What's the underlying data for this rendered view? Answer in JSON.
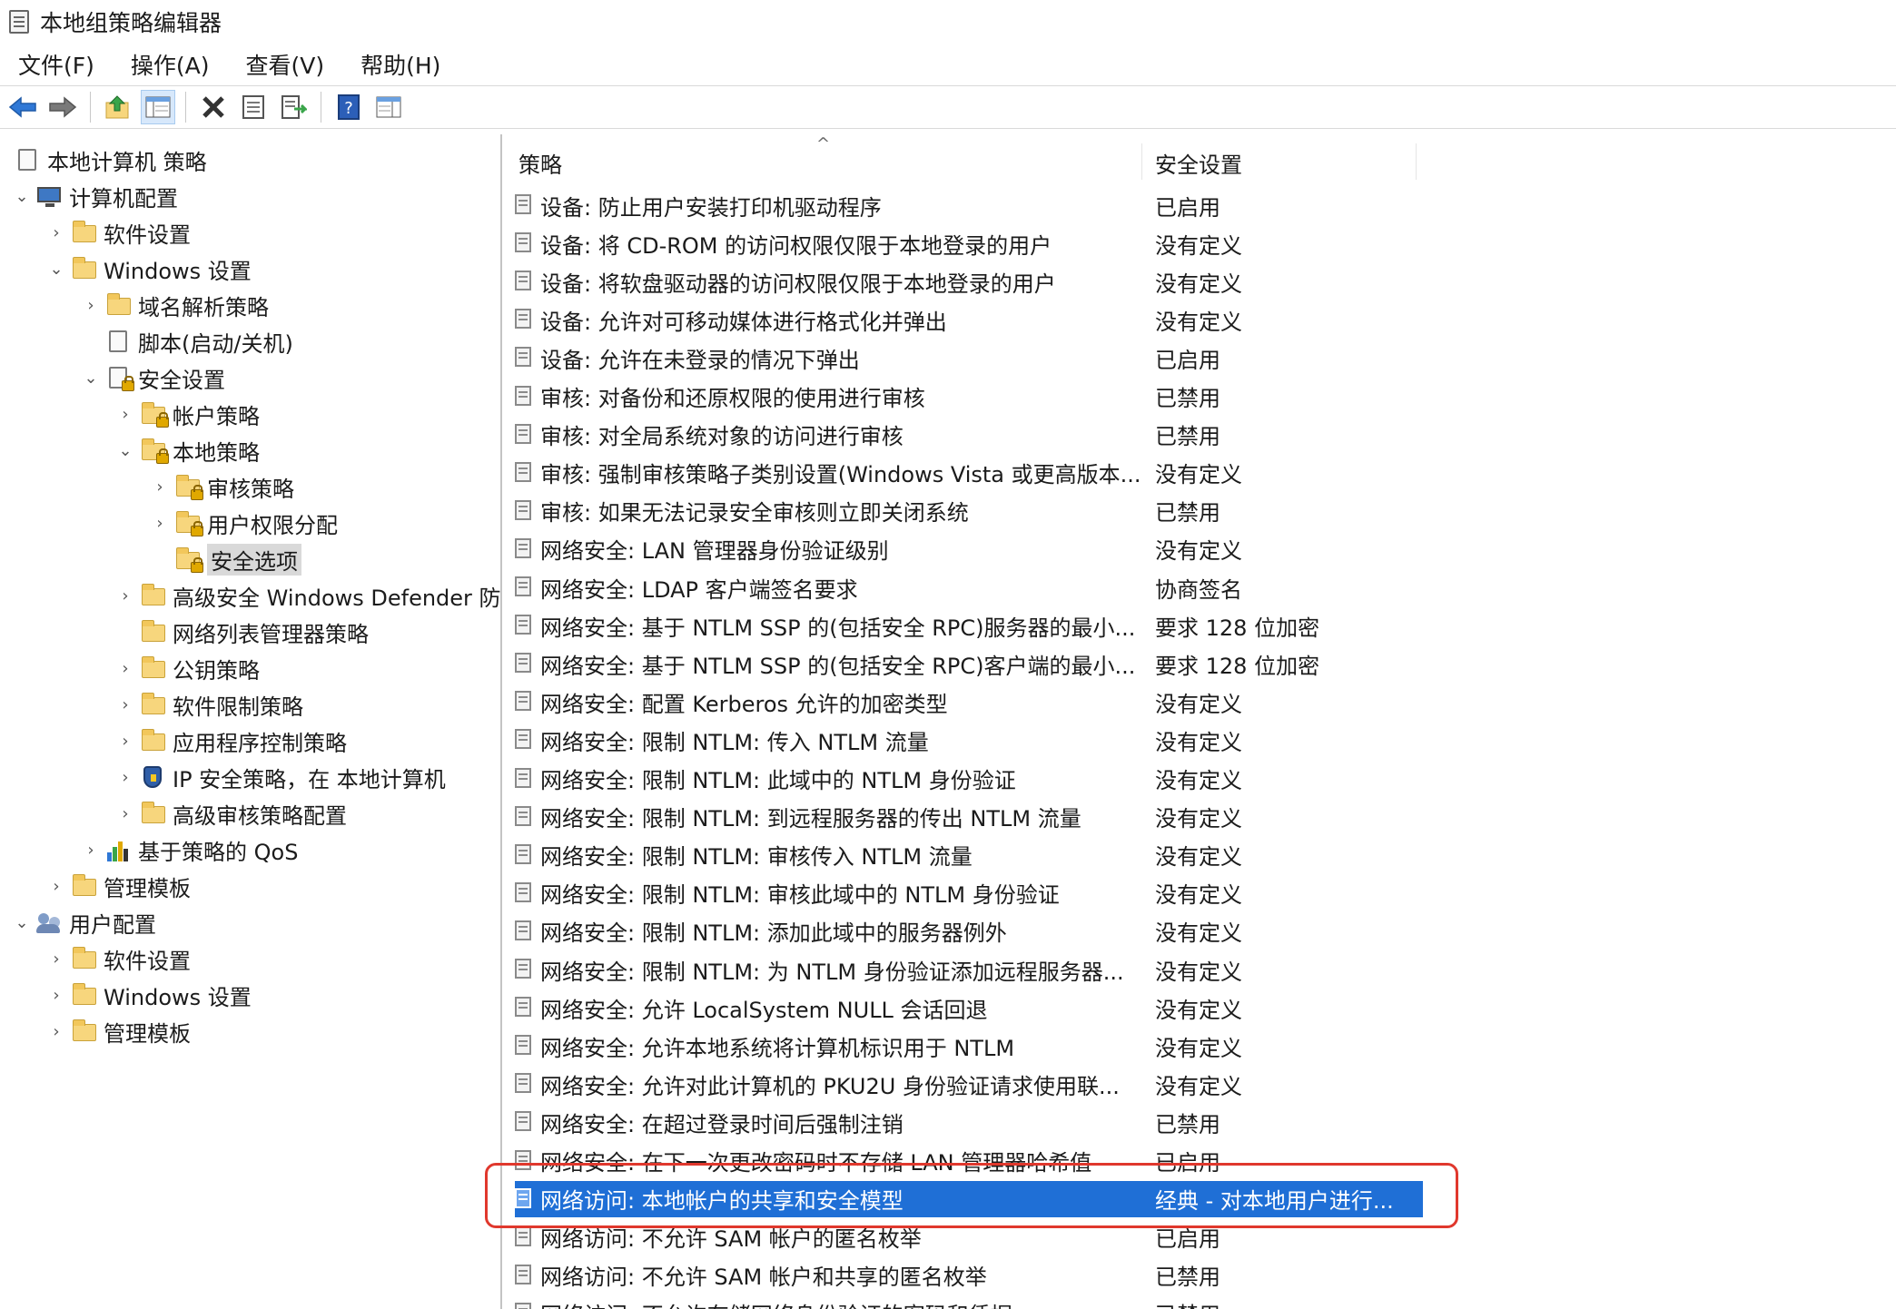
{
  "window": {
    "title": "本地组策略编辑器"
  },
  "menu": [
    "文件(F)",
    "操作(A)",
    "查看(V)",
    "帮助(H)"
  ],
  "toolbar_icons": [
    "back-icon",
    "forward-icon",
    "up-folder-icon",
    "show-hide-tree-icon",
    "delete-icon",
    "properties-icon",
    "export-list-icon",
    "help-icon",
    "show-action-pane-icon"
  ],
  "tree": [
    {
      "label": "本地计算机 策略",
      "icon": "doc"
    },
    {
      "label": "计算机配置",
      "icon": "pc",
      "expanded": true
    },
    {
      "label": "软件设置",
      "icon": "folder"
    },
    {
      "label": "Windows 设置",
      "icon": "folder",
      "expanded": true
    },
    {
      "label": "域名解析策略",
      "icon": "folder"
    },
    {
      "label": "脚本(启动/关机)",
      "icon": "doc"
    },
    {
      "label": "安全设置",
      "icon": "doc-lock",
      "expanded": true
    },
    {
      "label": "帐户策略",
      "icon": "folder-lock"
    },
    {
      "label": "本地策略",
      "icon": "folder-lock",
      "expanded": true
    },
    {
      "label": "审核策略",
      "icon": "folder-lock"
    },
    {
      "label": "用户权限分配",
      "icon": "folder-lock"
    },
    {
      "label": "安全选项",
      "icon": "folder-lock",
      "selected": true
    },
    {
      "label": "高级安全 Windows Defender 防",
      "icon": "folder"
    },
    {
      "label": "网络列表管理器策略",
      "icon": "folder"
    },
    {
      "label": "公钥策略",
      "icon": "folder"
    },
    {
      "label": "软件限制策略",
      "icon": "folder"
    },
    {
      "label": "应用程序控制策略",
      "icon": "folder"
    },
    {
      "label": "IP 安全策略，在 本地计算机",
      "icon": "shield"
    },
    {
      "label": "高级审核策略配置",
      "icon": "folder"
    },
    {
      "label": "基于策略的 QoS",
      "icon": "bars"
    },
    {
      "label": "管理模板",
      "icon": "folder"
    },
    {
      "label": "用户配置",
      "icon": "users",
      "expanded": true
    },
    {
      "label": "软件设置",
      "icon": "folder"
    },
    {
      "label": "Windows 设置",
      "icon": "folder"
    },
    {
      "label": "管理模板",
      "icon": "folder"
    }
  ],
  "list": {
    "columns": [
      "策略",
      "安全设置"
    ],
    "rows": [
      {
        "policy": "设备: 防止用户安装打印机驱动程序",
        "setting": "已启用"
      },
      {
        "policy": "设备: 将 CD-ROM 的访问权限仅限于本地登录的用户",
        "setting": "没有定义"
      },
      {
        "policy": "设备: 将软盘驱动器的访问权限仅限于本地登录的用户",
        "setting": "没有定义"
      },
      {
        "policy": "设备: 允许对可移动媒体进行格式化并弹出",
        "setting": "没有定义"
      },
      {
        "policy": "设备: 允许在未登录的情况下弹出",
        "setting": "已启用"
      },
      {
        "policy": "审核: 对备份和还原权限的使用进行审核",
        "setting": "已禁用"
      },
      {
        "policy": "审核: 对全局系统对象的访问进行审核",
        "setting": "已禁用"
      },
      {
        "policy": "审核: 强制审核策略子类别设置(Windows Vista 或更高版本...",
        "setting": "没有定义"
      },
      {
        "policy": "审核: 如果无法记录安全审核则立即关闭系统",
        "setting": "已禁用"
      },
      {
        "policy": "网络安全: LAN 管理器身份验证级别",
        "setting": "没有定义"
      },
      {
        "policy": "网络安全: LDAP 客户端签名要求",
        "setting": "协商签名"
      },
      {
        "policy": "网络安全: 基于 NTLM SSP 的(包括安全 RPC)服务器的最小...",
        "setting": "要求 128 位加密"
      },
      {
        "policy": "网络安全: 基于 NTLM SSP 的(包括安全 RPC)客户端的最小...",
        "setting": "要求 128 位加密"
      },
      {
        "policy": "网络安全: 配置 Kerberos 允许的加密类型",
        "setting": "没有定义"
      },
      {
        "policy": "网络安全: 限制 NTLM: 传入 NTLM 流量",
        "setting": "没有定义"
      },
      {
        "policy": "网络安全: 限制 NTLM: 此域中的 NTLM 身份验证",
        "setting": "没有定义"
      },
      {
        "policy": "网络安全: 限制 NTLM: 到远程服务器的传出 NTLM 流量",
        "setting": "没有定义"
      },
      {
        "policy": "网络安全: 限制 NTLM: 审核传入 NTLM 流量",
        "setting": "没有定义"
      },
      {
        "policy": "网络安全: 限制 NTLM: 审核此域中的 NTLM 身份验证",
        "setting": "没有定义"
      },
      {
        "policy": "网络安全: 限制 NTLM: 添加此域中的服务器例外",
        "setting": "没有定义"
      },
      {
        "policy": "网络安全: 限制 NTLM: 为 NTLM 身份验证添加远程服务器...",
        "setting": "没有定义"
      },
      {
        "policy": "网络安全: 允许 LocalSystem NULL 会话回退",
        "setting": "没有定义"
      },
      {
        "policy": "网络安全: 允许本地系统将计算机标识用于 NTLM",
        "setting": "没有定义"
      },
      {
        "policy": "网络安全: 允许对此计算机的 PKU2U 身份验证请求使用联...",
        "setting": "没有定义"
      },
      {
        "policy": "网络安全: 在超过登录时间后强制注销",
        "setting": "已禁用"
      },
      {
        "policy": "网络安全: 在下一次更改密码时不存储 LAN 管理器哈希值",
        "setting": "已启用"
      },
      {
        "policy": "网络访问: 本地帐户的共享和安全模型",
        "setting": "经典 - 对本地用户进行...",
        "selected": true
      },
      {
        "policy": "网络访问: 不允许 SAM 帐户的匿名枚举",
        "setting": "已启用"
      },
      {
        "policy": "网络访问: 不允许 SAM 帐户和共享的匿名枚举",
        "setting": "已禁用"
      },
      {
        "policy": "网络访问: 不允许存储网络身份验证的密码和凭据",
        "setting": "已禁用"
      }
    ]
  },
  "colors": {
    "selection": "#1f6fd6",
    "highlight_box": "#e0382d"
  }
}
